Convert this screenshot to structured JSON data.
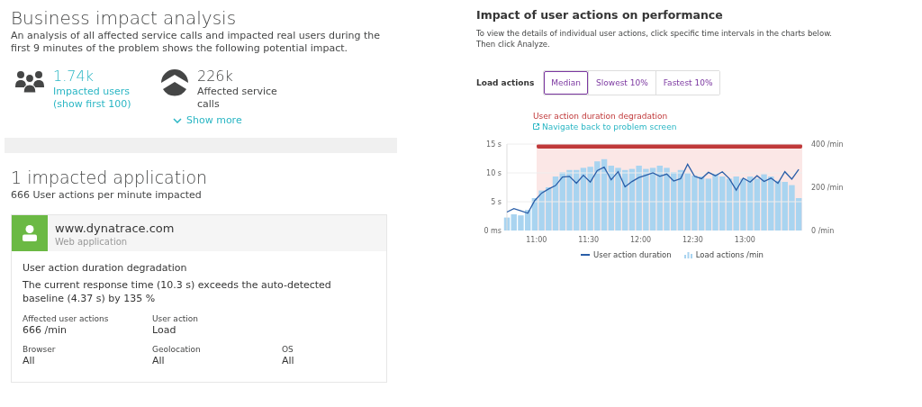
{
  "business_impact": {
    "title": "Business impact analysis",
    "description": "An analysis of all affected service calls and impacted real users during the first 9 minutes of the problem shows the following potential impact.",
    "stats": [
      {
        "kind": "users",
        "value": "1.74k",
        "label": "Impacted users (show first 100)"
      },
      {
        "kind": "services",
        "value": "226k",
        "label": "Affected service calls"
      }
    ],
    "show_more": "Show more"
  },
  "applications": {
    "title": "1 impacted application",
    "subtitle": "666 User actions per minute impacted",
    "card": {
      "name": "www.dynatrace.com",
      "type": "Web application",
      "issue": "User action duration degradation",
      "detail": "The current response time (10.3 s) exceeds the auto-detected baseline (4.37 s) by 135 %",
      "fields": [
        {
          "label": "Affected user actions",
          "value": "666 /min"
        },
        {
          "label": "User action",
          "value": "Load"
        },
        {
          "label": "Browser",
          "value": "All"
        },
        {
          "label": "Geolocation",
          "value": "All"
        },
        {
          "label": "OS",
          "value": "All"
        }
      ]
    }
  },
  "performance": {
    "title": "Impact of user actions on performance",
    "description": "To view the details of individual user actions, click specific time intervals in the charts below. Then click Analyze.",
    "filter_label": "Load actions",
    "segments": [
      {
        "label": "Median",
        "selected": true
      },
      {
        "label": "Slowest 10%",
        "selected": false
      },
      {
        "label": "Fastest 10%",
        "selected": false
      }
    ],
    "event_label": "User action duration degradation",
    "event_link": "Navigate back to problem screen",
    "chart_data": {
      "type": "line",
      "x": [
        643,
        647,
        651,
        655,
        659,
        663,
        667,
        671,
        675,
        679,
        683,
        687,
        691,
        695,
        699,
        703,
        707,
        711,
        715,
        719,
        723,
        727,
        731,
        735,
        739,
        743,
        747,
        751,
        755,
        759,
        763,
        767,
        771,
        775,
        779,
        783,
        787,
        791,
        795,
        799,
        803,
        807,
        811
      ],
      "xlim": [
        643,
        813
      ],
      "ylim": [
        0,
        15
      ],
      "xticks": [
        {
          "value": 660,
          "label": "11:00"
        },
        {
          "value": 690,
          "label": "11:30"
        },
        {
          "value": 720,
          "label": "12:00"
        },
        {
          "value": 750,
          "label": "12:30"
        },
        {
          "value": 780,
          "label": "13:00"
        }
      ],
      "yticks": [
        {
          "value": 0,
          "label": "0 ms"
        },
        {
          "value": 5,
          "label": "5 s"
        },
        {
          "value": 10,
          "label": "10 s"
        },
        {
          "value": 15,
          "label": "15 s"
        }
      ],
      "series": [
        {
          "name": "User action duration",
          "color": "#2a5ea8",
          "values": [
            3.2,
            3.8,
            3.4,
            3.0,
            5.2,
            6.5,
            7.2,
            7.8,
            9.3,
            9.4,
            8.2,
            9.6,
            8.4,
            10.4,
            11.0,
            8.8,
            10.2,
            7.6,
            8.5,
            9.2,
            9.6,
            10.0,
            9.4,
            9.8,
            8.6,
            9.0,
            11.5,
            9.4,
            9.0,
            10.1,
            9.5,
            10.2,
            9.0,
            7.0,
            9.1,
            8.4,
            9.5,
            8.5,
            9.1,
            8.2,
            10.2,
            8.9,
            10.6
          ]
        }
      ]
    },
    "load_chart": {
      "chart_data": {
        "type": "bar",
        "x": [
          643,
          647,
          651,
          655,
          659,
          663,
          667,
          671,
          675,
          679,
          683,
          687,
          691,
          695,
          699,
          703,
          707,
          711,
          715,
          719,
          723,
          727,
          731,
          735,
          739,
          743,
          747,
          751,
          755,
          759,
          763,
          767,
          771,
          775,
          779,
          783,
          787,
          791,
          795,
          799,
          803,
          807,
          811
        ],
        "xlim": [
          643,
          813
        ],
        "ylim": [
          0,
          400
        ],
        "yticks": [
          {
            "value": 0,
            "label": "0 /min"
          },
          {
            "value": 200,
            "label": "200 /min"
          },
          {
            "value": 400,
            "label": "400 /min"
          }
        ],
        "series": [
          {
            "name": "Load actions /min",
            "color": "#a9d4f0",
            "values": [
              60,
              75,
              70,
              95,
              150,
              185,
              200,
              250,
              270,
              280,
              280,
              290,
              295,
              320,
              330,
              300,
              290,
              280,
              285,
              300,
              285,
              290,
              300,
              290,
              270,
              280,
              265,
              255,
              250,
              240,
              260,
              250,
              240,
              250,
              240,
              250,
              240,
              260,
              250,
              230,
              225,
              210,
              150
            ]
          }
        ]
      }
    }
  }
}
